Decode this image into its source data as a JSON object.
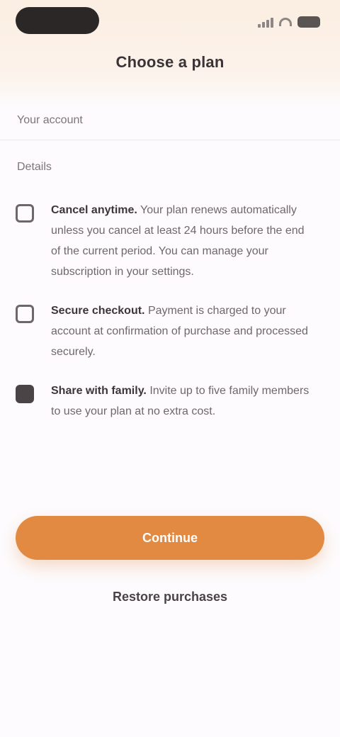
{
  "header": {
    "title": "Choose a plan"
  },
  "sections": {
    "row1_label": "Your account",
    "row2_label": "Details"
  },
  "info_items": [
    {
      "title": "Cancel anytime.",
      "body": "Your plan renews automatically unless you cancel at least 24 hours before the end of the current period. You can manage your subscription in your settings."
    },
    {
      "title": "Secure checkout.",
      "body": "Payment is charged to your account at confirmation of purchase and processed securely."
    },
    {
      "title": "Share with family.",
      "body": "Invite up to five family members to use your plan at no extra cost."
    }
  ],
  "actions": {
    "primary_label": "Continue",
    "secondary_label": "Restore purchases"
  },
  "icons": {
    "status_signal": "signal-icon",
    "status_wifi": "wifi-icon",
    "status_battery": "battery-icon",
    "item1": "calendar-icon",
    "item2": "lock-icon",
    "item3": "people-icon"
  },
  "colors": {
    "accent": "#e28a41",
    "header_tint": "#fbeee2",
    "background": "#fdfbfd"
  }
}
